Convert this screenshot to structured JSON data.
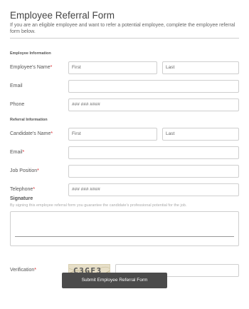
{
  "form": {
    "title": "Employee Referral Form",
    "intro": "If you are an eligible employee and want to refer a potential employee, complete the employee referral form below."
  },
  "employee_section": {
    "label": "Employee Information",
    "name_label": "Employee's Name",
    "name_first_placeholder": "First",
    "name_last_placeholder": "Last",
    "email_label": "Email",
    "email_value": "",
    "phone_label": "Phone",
    "phone_placeholder": "### ### ####"
  },
  "referral_section": {
    "label": "Referral Information",
    "name_label": "Candidate's Name",
    "name_first_placeholder": "First",
    "name_last_placeholder": "Last",
    "email_label": "Email",
    "email_value": "",
    "position_label": "Job Position",
    "position_value": "",
    "phone_label": "Telephone",
    "phone_placeholder": "### ### ####"
  },
  "required_marker": "*",
  "signature": {
    "label": "Signature",
    "hint": "By signing this employee referral form you guarantee the candidate's professional potential for the job."
  },
  "verification": {
    "label": "Verification",
    "captcha_text": "C3GF3",
    "input_value": ""
  },
  "submit_label": "Submit Employee Referral Form",
  "colors": {
    "required": "#d9262b",
    "button": "#4b4b4b",
    "border": "#cfcfcf"
  }
}
